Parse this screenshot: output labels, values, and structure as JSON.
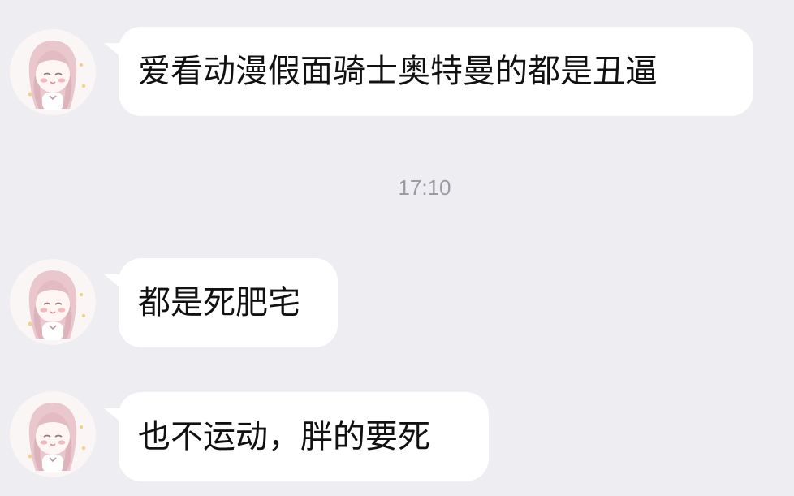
{
  "chat": {
    "timestamp": "17:10",
    "messages": [
      {
        "text": "爱看动漫假面骑士奥特曼的都是丑逼"
      },
      {
        "text": "都是死肥宅"
      },
      {
        "text": "也不运动，胖的要死"
      }
    ]
  },
  "style": {
    "background": "#ededf2",
    "bubble": "#ffffff",
    "text": "#111111",
    "timestamp": "#9b9ba3"
  },
  "icons": {
    "avatar": "anime-girl-avatar-icon"
  }
}
